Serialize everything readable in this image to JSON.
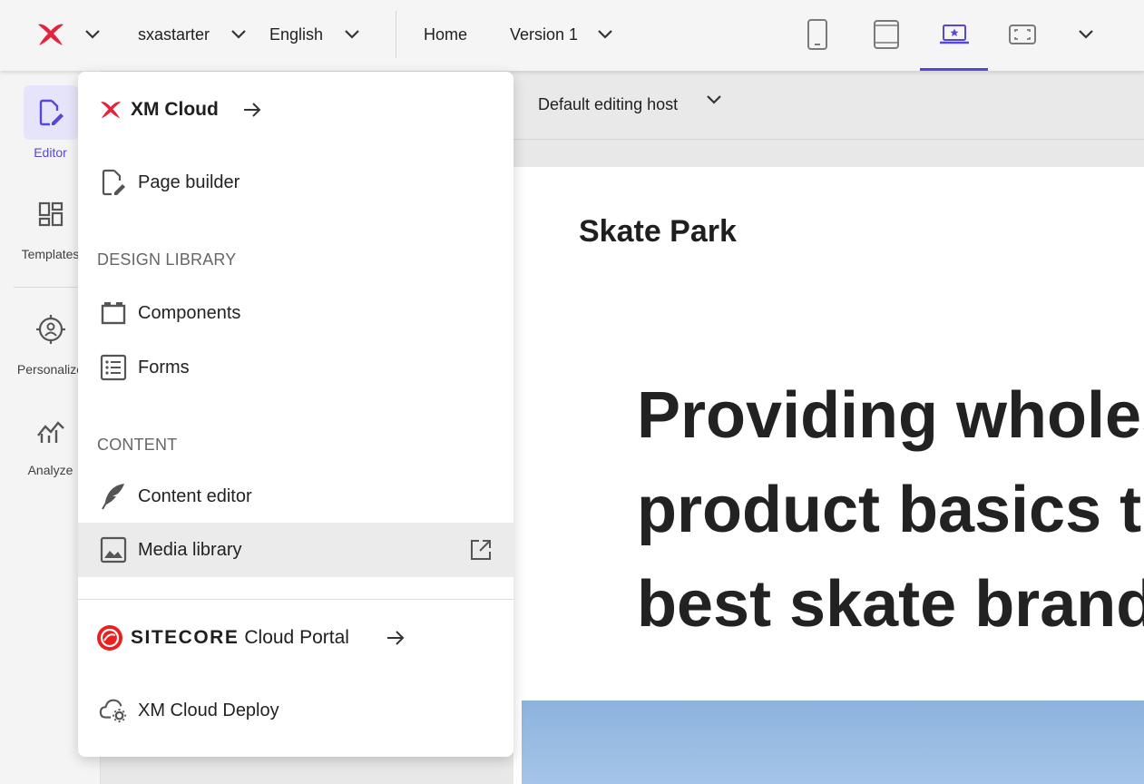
{
  "topbar": {
    "site": "sxastarter",
    "language": "English",
    "page": "Home",
    "version": "Version 1",
    "devices": [
      "mobile-device-icon",
      "tablet-device-icon",
      "laptop-device-icon",
      "fit-screen-icon"
    ],
    "accent": "#5548d9",
    "brand_red": "#e4233d"
  },
  "rail": {
    "items": [
      {
        "label": "Editor",
        "icon": "editor-icon",
        "active": true
      },
      {
        "label": "Templates",
        "icon": "templates-icon"
      },
      {
        "label": "Personalize",
        "icon": "personalize-icon"
      },
      {
        "label": "Analyze",
        "icon": "analyze-icon"
      }
    ]
  },
  "canvas": {
    "editing_host": "Default editing host",
    "site_name": "Skate Park",
    "hero_lines": [
      "Providing wholes",
      "product basics to",
      "best skate brand"
    ]
  },
  "menu": {
    "xm_cloud": "XM Cloud",
    "page_builder": "Page builder",
    "design_library_heading": "DESIGN LIBRARY",
    "components": "Components",
    "forms": "Forms",
    "content_heading": "CONTENT",
    "content_editor": "Content editor",
    "media_library": "Media library",
    "sitecore_brand": "SITECORE",
    "cloud_portal": "Cloud Portal",
    "xm_cloud_deploy": "XM Cloud Deploy"
  }
}
